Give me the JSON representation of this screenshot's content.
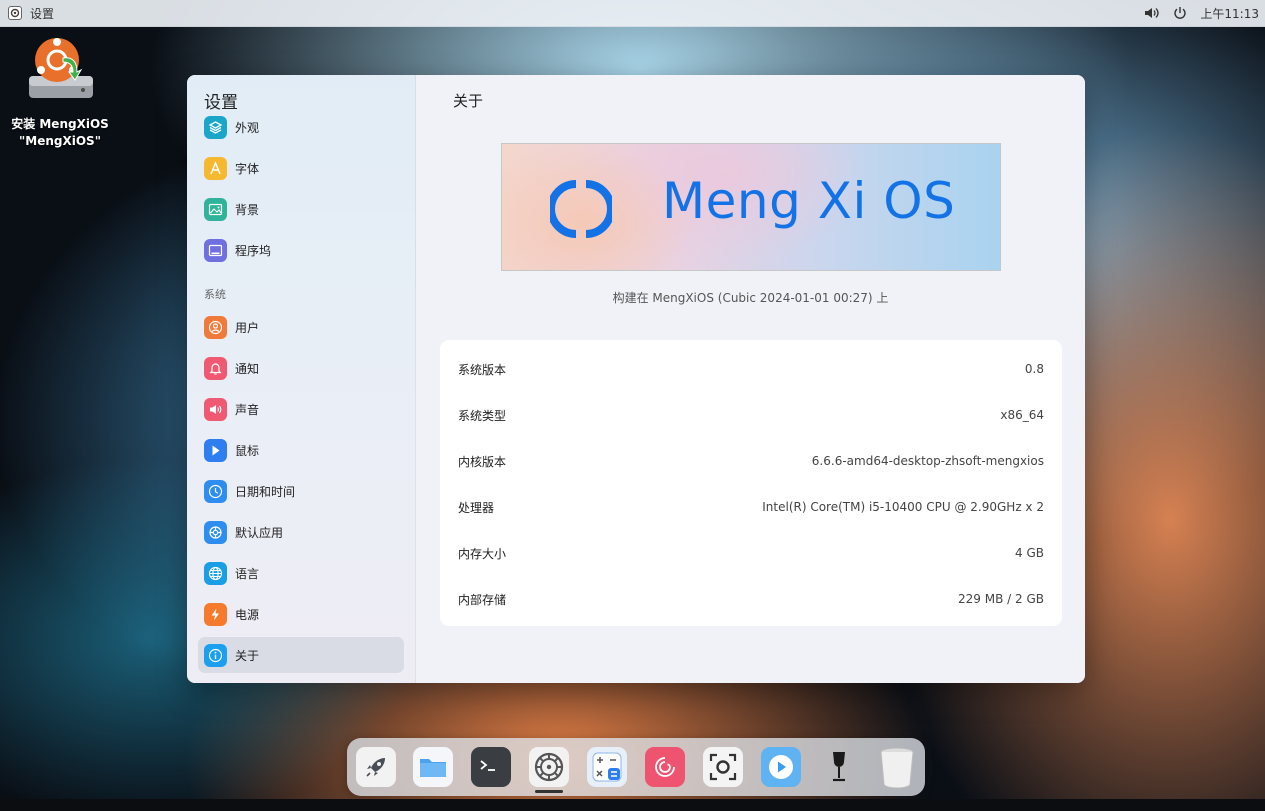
{
  "topbar": {
    "app_title": "设置",
    "clock": "上午11:13",
    "icons": [
      "settings-app-icon",
      "volume-icon",
      "power-icon"
    ]
  },
  "desktop": {
    "icon_label_line1": "安装 MengXiOS",
    "icon_label_line2": "\"MengXiOS\""
  },
  "sidebar": {
    "title": "设置",
    "section_system": "系统",
    "items": [
      {
        "label": "外观",
        "icon": "appearance-icon",
        "color": "#1aa6c8"
      },
      {
        "label": "字体",
        "icon": "font-icon",
        "color": "#f5b82e"
      },
      {
        "label": "背景",
        "icon": "wallpaper-icon",
        "color": "#2fb39a"
      },
      {
        "label": "程序坞",
        "icon": "dock-icon",
        "color": "#6f6fe0"
      },
      {
        "label": "用户",
        "icon": "user-icon",
        "color": "#f07a3a"
      },
      {
        "label": "通知",
        "icon": "bell-icon",
        "color": "#ef5a72"
      },
      {
        "label": "声音",
        "icon": "sound-icon",
        "color": "#ef5a72"
      },
      {
        "label": "鼠标",
        "icon": "cursor-icon",
        "color": "#2e7ef0"
      },
      {
        "label": "日期和时间",
        "icon": "clock-icon",
        "color": "#2e8ef0"
      },
      {
        "label": "默认应用",
        "icon": "default-apps-icon",
        "color": "#2e8ef0"
      },
      {
        "label": "语言",
        "icon": "globe-icon",
        "color": "#1a9ee6"
      },
      {
        "label": "电源",
        "icon": "power-bolt-icon",
        "color": "#f57a2c"
      },
      {
        "label": "关于",
        "icon": "info-icon",
        "color": "#1aa0ee"
      }
    ]
  },
  "main": {
    "title": "关于",
    "banner_text": "Meng Xi OS",
    "build_line": "构建在 MengXiOS (Cubic 2024-01-01 00:27) 上",
    "info": [
      {
        "key": "系统版本",
        "value": "0.8"
      },
      {
        "key": "系统类型",
        "value": "x86_64"
      },
      {
        "key": "内核版本",
        "value": "6.6.6-amd64-desktop-zhsoft-mengxios"
      },
      {
        "key": "处理器",
        "value": "Intel(R) Core(TM) i5-10400 CPU @ 2.90GHz x 2"
      },
      {
        "key": "内存大小",
        "value": "4 GB"
      },
      {
        "key": "内部存储",
        "value": "229 MB / 2 GB"
      }
    ]
  },
  "dock": {
    "items": [
      "launcher-icon",
      "files-icon",
      "terminal-icon",
      "settings-icon",
      "calculator-icon",
      "debian-app-icon",
      "screenshot-icon",
      "media-player-icon",
      "wine-icon",
      "trash-icon"
    ]
  },
  "colors": {
    "accent": "#1373e6"
  }
}
